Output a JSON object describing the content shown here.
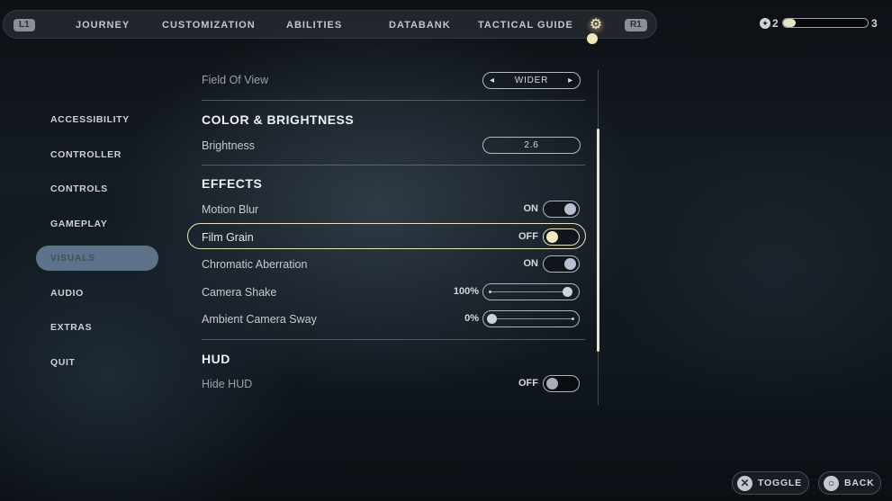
{
  "topnav": {
    "left_bumper": "L1",
    "right_bumper": "R1",
    "tabs": [
      "JOURNEY",
      "CUSTOMIZATION",
      "ABILITIES",
      "DATABANK",
      "TACTICAL GUIDE"
    ],
    "active_tab_icon": "gear-icon"
  },
  "xp": {
    "current_level": "2",
    "next_level": "3",
    "progress_percent": 15
  },
  "sidebar": {
    "items": [
      "ACCESSIBILITY",
      "CONTROLLER",
      "CONTROLS",
      "GAMEPLAY",
      "VISUALS",
      "AUDIO",
      "EXTRAS",
      "QUIT"
    ],
    "active": "VISUALS"
  },
  "settings": {
    "field_of_view": {
      "label": "Field Of View",
      "value": "WIDER"
    },
    "color_section": "COLOR & BRIGHTNESS",
    "brightness": {
      "label": "Brightness",
      "value": "2.6"
    },
    "effects_section": "EFFECTS",
    "motion_blur": {
      "label": "Motion Blur",
      "state": "ON"
    },
    "film_grain": {
      "label": "Film Grain",
      "state": "OFF"
    },
    "chromatic_aberration": {
      "label": "Chromatic Aberration",
      "state": "ON"
    },
    "camera_shake": {
      "label": "Camera Shake",
      "value": "100%",
      "percent": 100
    },
    "ambient_camera_sway": {
      "label": "Ambient Camera Sway",
      "value": "0%",
      "percent": 0
    },
    "hud_section": "HUD",
    "hide_hud": {
      "label": "Hide HUD",
      "state": "OFF"
    }
  },
  "hints": {
    "toggle": "TOGGLE",
    "back": "BACK"
  },
  "colors": {
    "accent": "#e6e1b8",
    "active_sidebar": "#5e7289"
  }
}
